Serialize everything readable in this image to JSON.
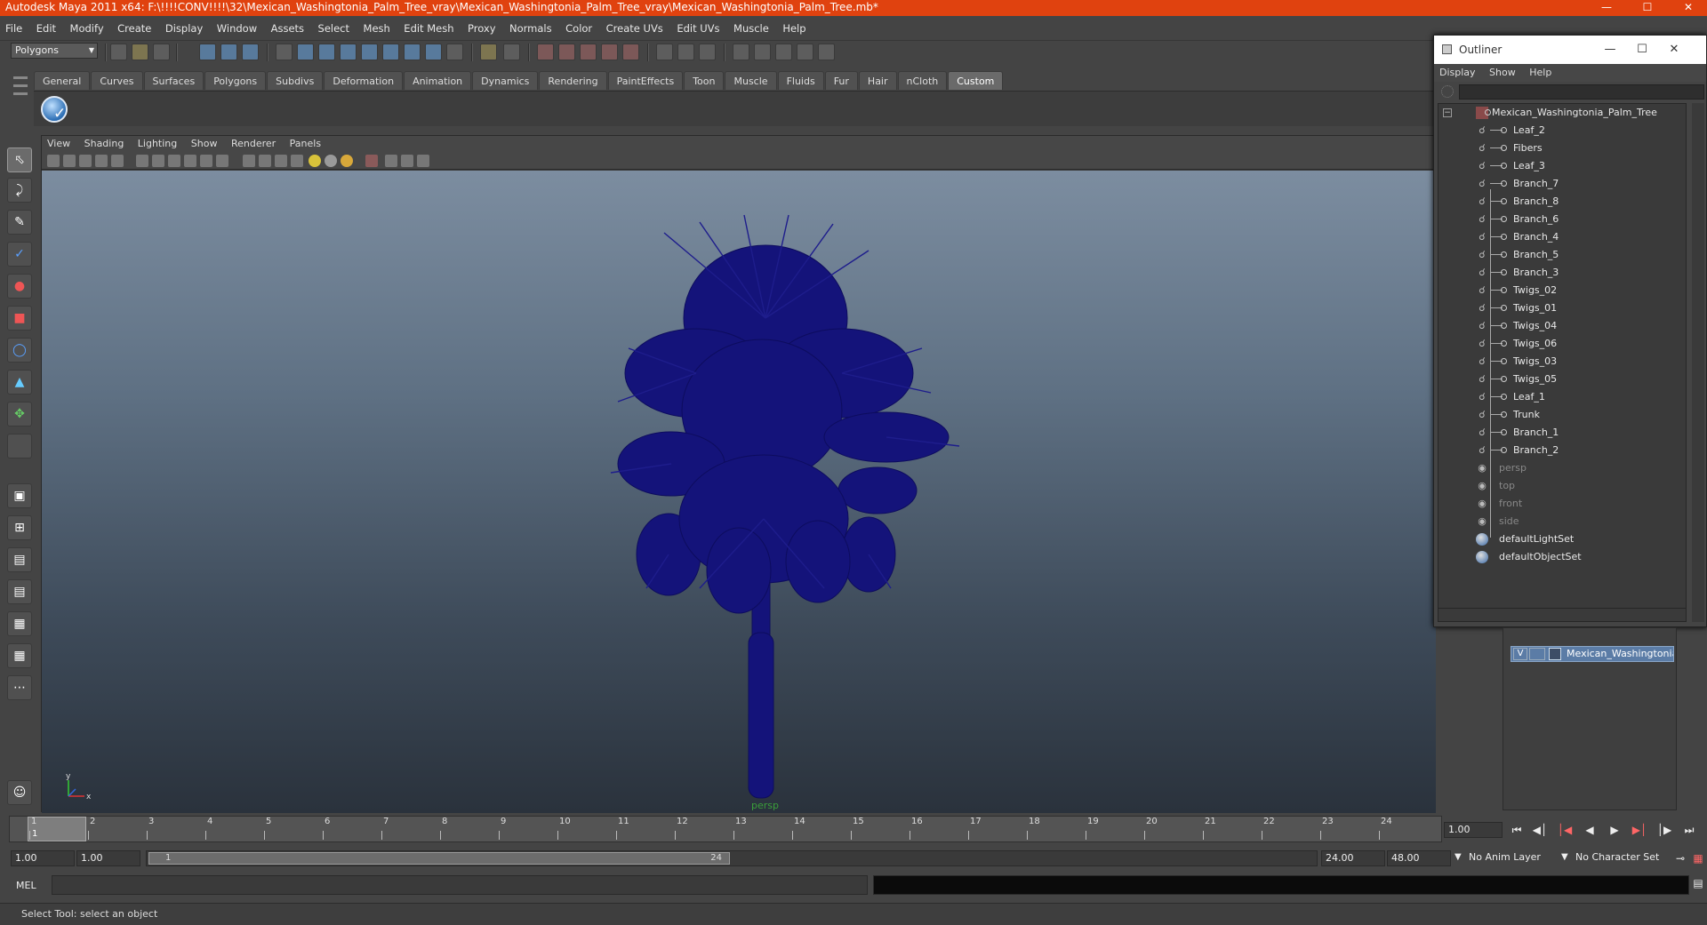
{
  "window": {
    "title": "Autodesk Maya 2011 x64: F:\\!!!!CONV!!!!\\32\\Mexican_Washingtonia_Palm_Tree_vray\\Mexican_Washingtonia_Palm_Tree_vray\\Mexican_Washingtonia_Palm_Tree.mb*"
  },
  "menubar": [
    "File",
    "Edit",
    "Modify",
    "Create",
    "Display",
    "Window",
    "Assets",
    "Select",
    "Mesh",
    "Edit Mesh",
    "Proxy",
    "Normals",
    "Color",
    "Create UVs",
    "Edit UVs",
    "Muscle",
    "Help"
  ],
  "mode_selector": {
    "value": "Polygons"
  },
  "shelf_tabs": [
    "General",
    "Curves",
    "Surfaces",
    "Polygons",
    "Subdivs",
    "Deformation",
    "Animation",
    "Dynamics",
    "Rendering",
    "PaintEffects",
    "Toon",
    "Muscle",
    "Fluids",
    "Fur",
    "Hair",
    "nCloth",
    "Custom"
  ],
  "active_shelf": "Custom",
  "viewport": {
    "menu": [
      "View",
      "Shading",
      "Lighting",
      "Show",
      "Renderer",
      "Panels"
    ],
    "camera_label": "persp",
    "axis_x": "x",
    "axis_y": "y"
  },
  "timeline": {
    "ticks": [
      "1",
      "2",
      "3",
      "4",
      "5",
      "6",
      "7",
      "8",
      "9",
      "10",
      "11",
      "12",
      "13",
      "14",
      "15",
      "16",
      "17",
      "18",
      "19",
      "20",
      "21",
      "22",
      "23",
      "24"
    ],
    "current_frame": "1",
    "current_time_field": "1.00"
  },
  "range": {
    "start": "1.00",
    "playback_start": "1.00",
    "slider_start": "1",
    "slider_end": "24",
    "playback_end": "24.00",
    "end": "48.00",
    "anim_layer": "No Anim Layer",
    "character_set": "No Character Set"
  },
  "command_line": {
    "label": "MEL"
  },
  "help_line": "Select Tool: select an object",
  "layer_editor": {
    "layers": [
      {
        "visible": "V",
        "name": "Mexican_Washingtonia_P"
      }
    ]
  },
  "outliner": {
    "title": "Outliner",
    "menu": [
      "Display",
      "Show",
      "Help"
    ],
    "root": "Mexican_Washingtonia_Palm_Tree",
    "children": [
      "Leaf_2",
      "Fibers",
      "Leaf_3",
      "Branch_7",
      "Branch_8",
      "Branch_6",
      "Branch_4",
      "Branch_5",
      "Branch_3",
      "Twigs_02",
      "Twigs_01",
      "Twigs_04",
      "Twigs_06",
      "Twigs_03",
      "Twigs_05",
      "Leaf_1",
      "Trunk",
      "Branch_1",
      "Branch_2"
    ],
    "cameras": [
      "persp",
      "top",
      "front",
      "side"
    ],
    "sets": [
      "defaultLightSet",
      "defaultObjectSet"
    ]
  },
  "colors": {
    "title_bar": "#e0420f",
    "model": "#14137a",
    "accent": "#5b7ca6"
  }
}
